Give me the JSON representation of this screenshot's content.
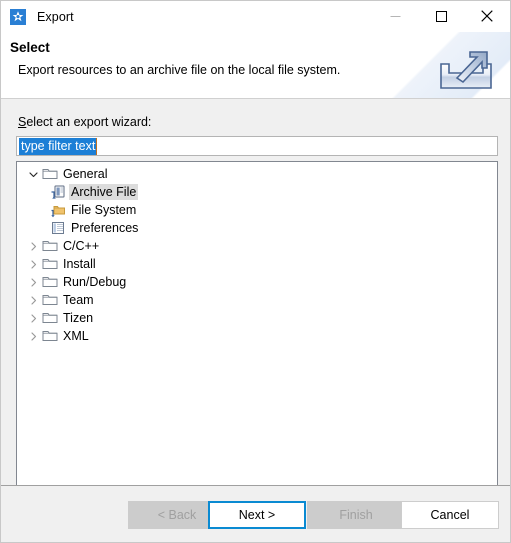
{
  "window": {
    "title": "Export",
    "app_icon": "tizen-star-icon",
    "controls": {
      "minimize": "minimize-icon",
      "maximize": "maximize-icon",
      "close": "close-icon"
    }
  },
  "banner": {
    "title": "Select",
    "description": "Export resources to an archive file on the local file system.",
    "icon": "export-tray-arrow-icon"
  },
  "form": {
    "wizard_label_prefix": "S",
    "wizard_label_rest": "elect an export wizard:",
    "filter": {
      "value": "type filter text",
      "placeholder": "type filter text",
      "selected": true
    }
  },
  "tree": {
    "items": [
      {
        "label": "General",
        "level": 0,
        "state": "expanded",
        "icon": "folder-icon",
        "selected": false
      },
      {
        "label": "Archive File",
        "level": 1,
        "state": "leaf",
        "icon": "archive-file-icon",
        "selected": true
      },
      {
        "label": "File System",
        "level": 1,
        "state": "leaf",
        "icon": "file-system-icon",
        "selected": false
      },
      {
        "label": "Preferences",
        "level": 1,
        "state": "leaf",
        "icon": "preferences-icon",
        "selected": false
      },
      {
        "label": "C/C++",
        "level": 0,
        "state": "collapsed",
        "icon": "folder-icon",
        "selected": false
      },
      {
        "label": "Install",
        "level": 0,
        "state": "collapsed",
        "icon": "folder-icon",
        "selected": false
      },
      {
        "label": "Run/Debug",
        "level": 0,
        "state": "collapsed",
        "icon": "folder-icon",
        "selected": false
      },
      {
        "label": "Team",
        "level": 0,
        "state": "collapsed",
        "icon": "folder-icon",
        "selected": false
      },
      {
        "label": "Tizen",
        "level": 0,
        "state": "collapsed",
        "icon": "folder-icon",
        "selected": false
      },
      {
        "label": "XML",
        "level": 0,
        "state": "collapsed",
        "icon": "folder-icon",
        "selected": false
      }
    ]
  },
  "buttons": {
    "back": {
      "label": "< Back",
      "state": "disabled"
    },
    "next": {
      "label": "Next >",
      "state": "default"
    },
    "finish": {
      "label": "Finish",
      "state": "disabled"
    },
    "cancel": {
      "label": "Cancel",
      "state": "normal"
    }
  },
  "colors": {
    "accent": "#0a8ad2",
    "selection": "#1c7fd6",
    "dialog_bg": "#f0f0f0",
    "panel_bg": "#ffffff",
    "tree_border": "#828790",
    "row_selected": "#dcdcdc"
  }
}
